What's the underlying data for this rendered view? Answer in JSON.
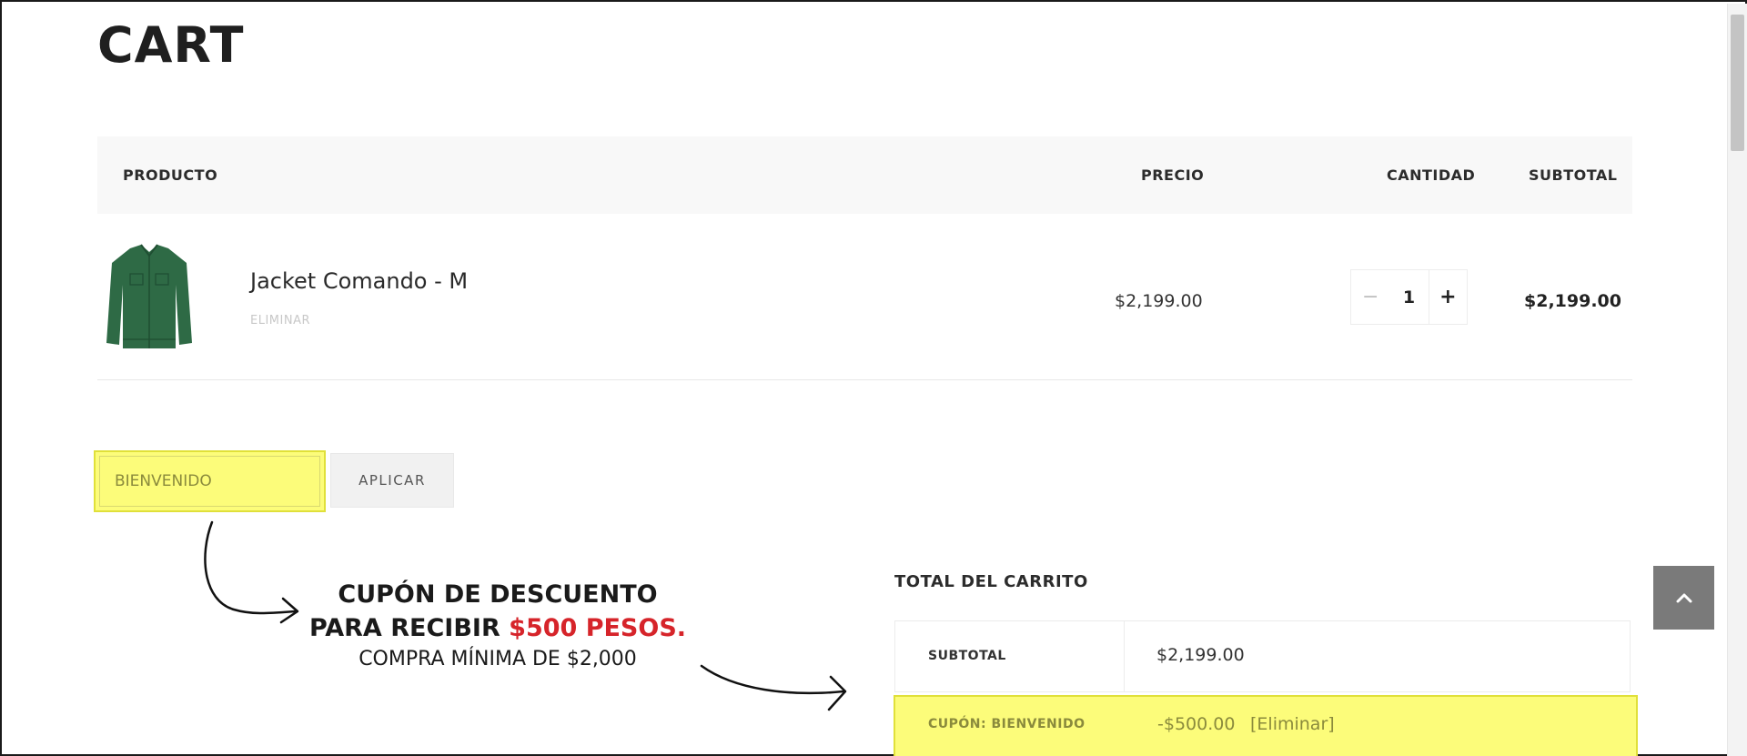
{
  "page": {
    "title": "CART"
  },
  "table": {
    "headers": {
      "product": "PRODUCTO",
      "price": "PRECIO",
      "quantity": "CANTIDAD",
      "subtotal": "SUBTOTAL"
    },
    "rows": [
      {
        "name": "Jacket Comando - M",
        "remove": "ELIMINAR",
        "price": "$2,199.00",
        "quantity": "1",
        "qty_minus": "−",
        "qty_plus": "+",
        "subtotal": "$2,199.00"
      }
    ]
  },
  "coupon": {
    "value": "BIENVENIDO",
    "apply_label": "APLICAR"
  },
  "annotation": {
    "line1": "CUPÓN DE DESCUENTO",
    "line2_prefix": "PARA RECIBIR ",
    "line2_highlight": "$500 PESOS.",
    "line3": "COMPRA MÍNIMA DE $2,000"
  },
  "totals": {
    "title": "TOTAL DEL CARRITO",
    "subtotal_label": "SUBTOTAL",
    "subtotal_value": "$2,199.00",
    "coupon_label": "CUPÓN: BIENVENIDO",
    "coupon_value": "-$500.00",
    "coupon_remove": "[Eliminar]"
  },
  "icons": {
    "scroll_top": "chevron-up-icon",
    "product_image": "green-jacket-image"
  },
  "colors": {
    "highlight": "#fcfc7a",
    "accent_red": "#d6242a",
    "scroll_button": "#7a7a7a"
  }
}
